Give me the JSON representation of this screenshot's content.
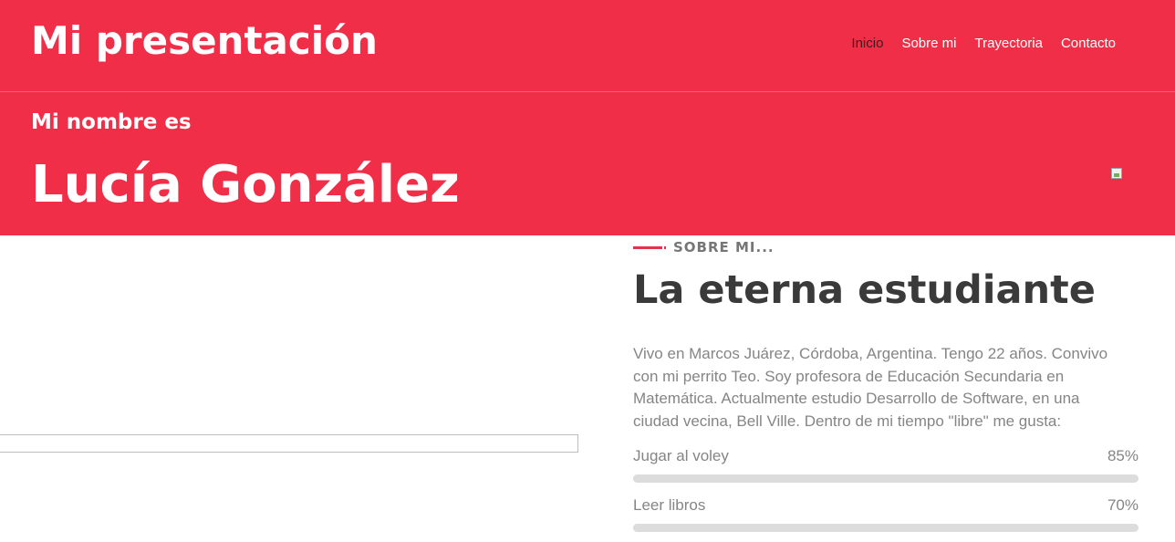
{
  "header": {
    "brand": "Mi presentación",
    "nav": [
      {
        "label": "Inicio",
        "active": true
      },
      {
        "label": "Sobre mi"
      },
      {
        "label": "Trayectoria"
      },
      {
        "label": "Contacto"
      }
    ],
    "intro": "Mi nombre es",
    "name": "Lucía González",
    "accent_color": "#f02e48"
  },
  "about": {
    "kicker": "SOBRE MI...",
    "title": "La eterna estudiante",
    "text": "Vivo en Marcos Juárez, Córdoba, Argentina. Tengo 22 años. Convivo con mi perrito Teo. Soy profesora de Educación Secundaria en Matemática. Actualmente estudio Desarrollo de Software, en una ciudad vecina, Bell Ville. Dentro de mi tiempo \"libre\" me gusta:",
    "skills": [
      {
        "label": "Jugar al voley",
        "percent": "85%",
        "value": 0.85
      },
      {
        "label": "Leer libros",
        "percent": "70%",
        "value": 0.7
      }
    ]
  }
}
